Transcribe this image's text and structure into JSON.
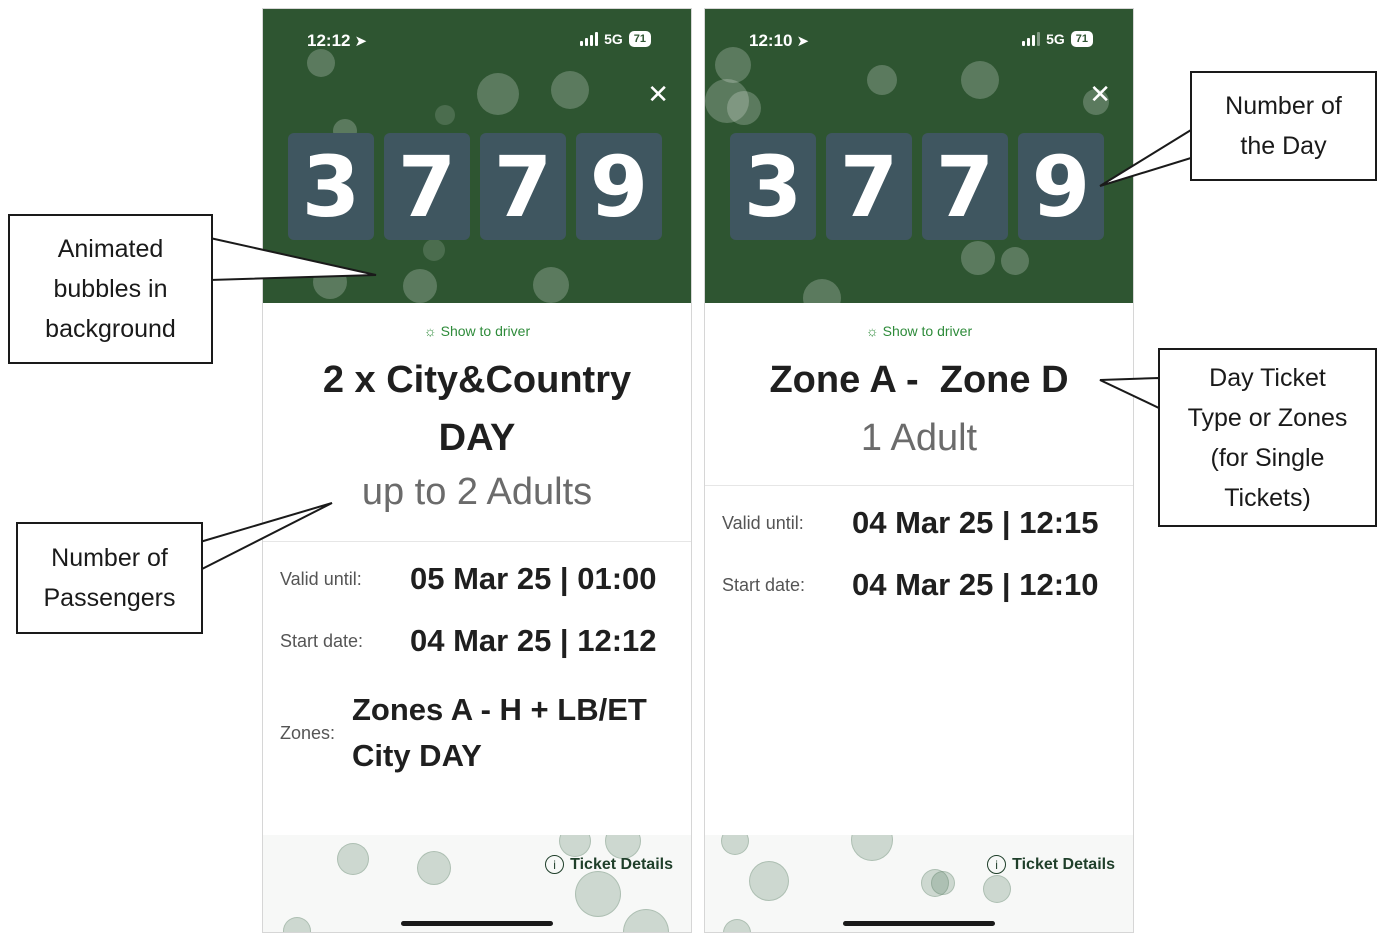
{
  "left_screen": {
    "status": {
      "time": "12:12",
      "network": "5G",
      "battery": "71"
    },
    "digits": [
      "3",
      "7",
      "7",
      "9"
    ],
    "show_driver": "Show to driver",
    "title_line1": "2 x City&Country",
    "title_line2": "DAY",
    "passengers": "up to 2 Adults",
    "valid_until_label": "Valid until:",
    "valid_until_value": "05 Mar 25 | 01:00",
    "start_date_label": "Start date:",
    "start_date_value": "04 Mar 25 | 12:12",
    "zones_label": "Zones:",
    "zones_line1": "Zones A - H + LB/ET",
    "zones_line2": "City DAY",
    "ticket_details": "Ticket Details"
  },
  "right_screen": {
    "status": {
      "time": "12:10",
      "network": "5G",
      "battery": "71"
    },
    "digits": [
      "3",
      "7",
      "7",
      "9"
    ],
    "show_driver": "Show to driver",
    "title_line1": "Zone A -  Zone D",
    "passengers": "1 Adult",
    "valid_until_label": "Valid until:",
    "valid_until_value": "04 Mar 25 | 12:15",
    "start_date_label": "Start date:",
    "start_date_value": "04 Mar 25 | 12:10",
    "ticket_details": "Ticket Details"
  },
  "callouts": {
    "bubbles": [
      "Animated",
      "bubbles in",
      "background"
    ],
    "passengers": [
      "Number of",
      "Passengers"
    ],
    "number_of_day": [
      "Number of",
      "the Day"
    ],
    "ticket_type": [
      "Day Ticket",
      "Type or Zones",
      "(for Single",
      "Tickets)"
    ]
  },
  "colors": {
    "header_green": "#2e5531",
    "digit_tile": "#3f5660",
    "accent_green": "#2e8b3a"
  },
  "icons": [
    "location-arrow-icon",
    "signal-icon",
    "battery-icon",
    "close-icon",
    "lightbulb-icon",
    "info-icon"
  ]
}
